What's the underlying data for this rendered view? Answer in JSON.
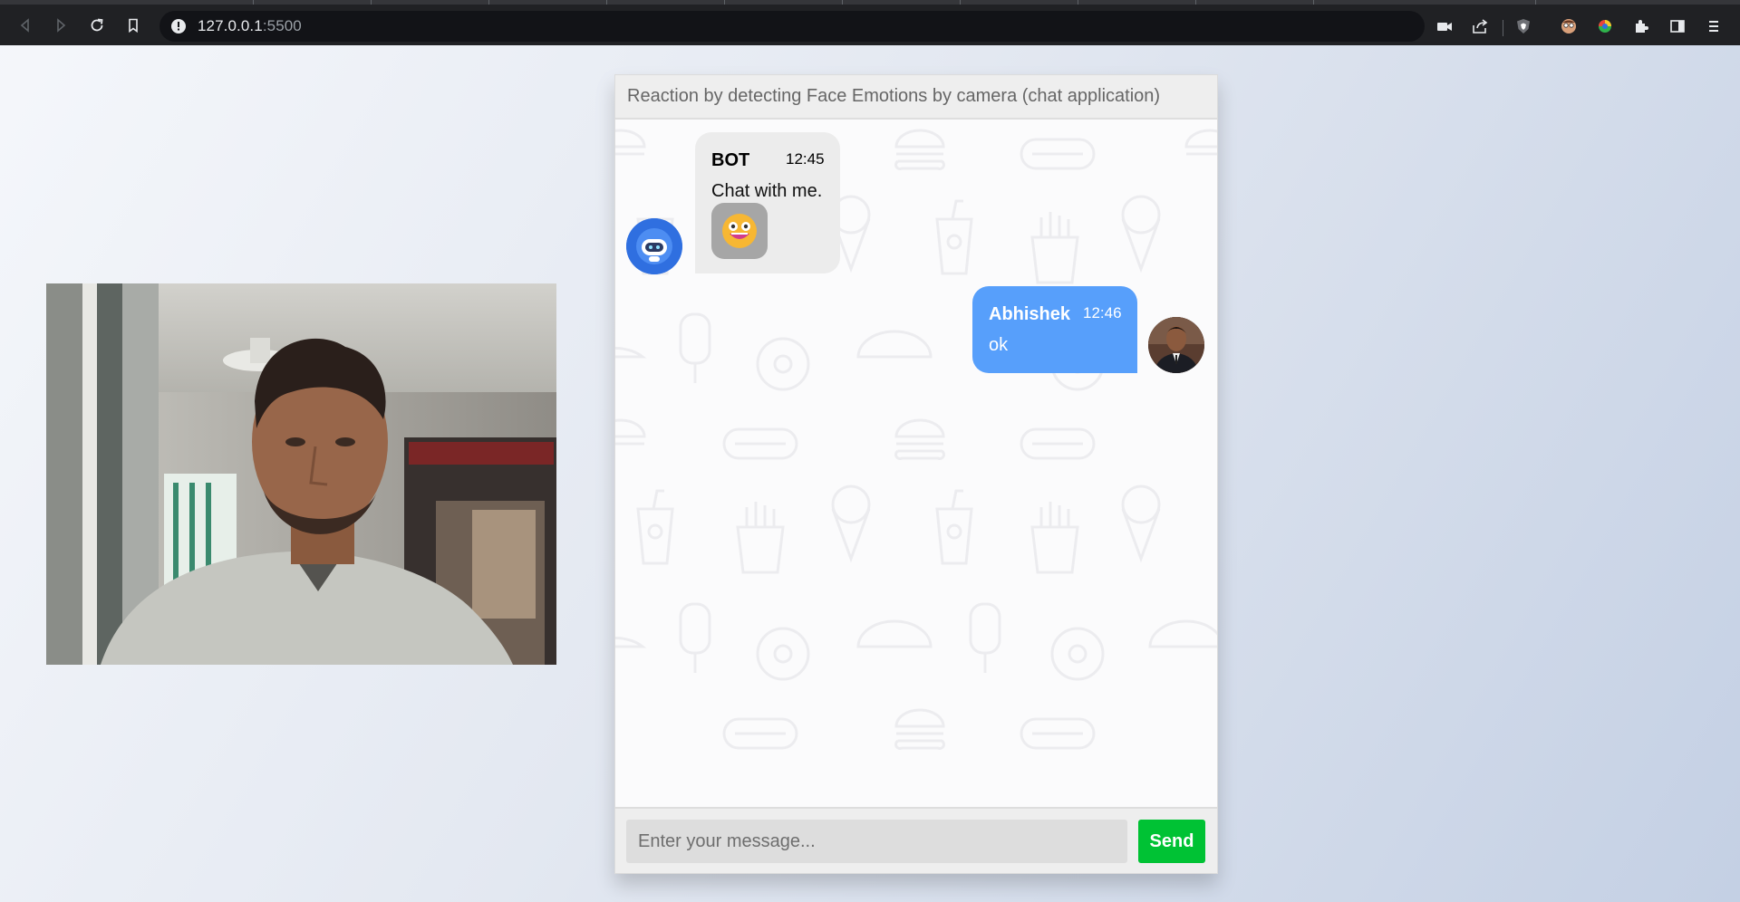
{
  "browser": {
    "url_host": "127.0.0.1",
    "url_port": ":5500"
  },
  "chat": {
    "header_title": "Reaction by detecting Face Emotions by camera (chat application)",
    "messages": [
      {
        "sender": "BOT",
        "time": "12:45",
        "text": "Chat with me.",
        "reaction": "grinning-face-emoji",
        "side": "left"
      },
      {
        "sender": "Abhishek",
        "time": "12:46",
        "text": "ok",
        "side": "right"
      }
    ],
    "input_placeholder": "Enter your message...",
    "send_label": "Send"
  },
  "colors": {
    "user_bubble": "#579ffb",
    "bot_bubble": "#ececec",
    "send_button": "#00c234",
    "bot_avatar": "#2f6fe0"
  },
  "icons": {
    "toolbar": [
      "back-icon",
      "forward-icon",
      "reload-icon",
      "bookmark-icon",
      "site-info-icon",
      "camera-in-use-icon",
      "share-icon",
      "brave-shield-icon",
      "extension-avatar-icon",
      "extension-color-icon",
      "puzzle-extensions-icon",
      "sidebar-icon",
      "menu-icon"
    ]
  }
}
